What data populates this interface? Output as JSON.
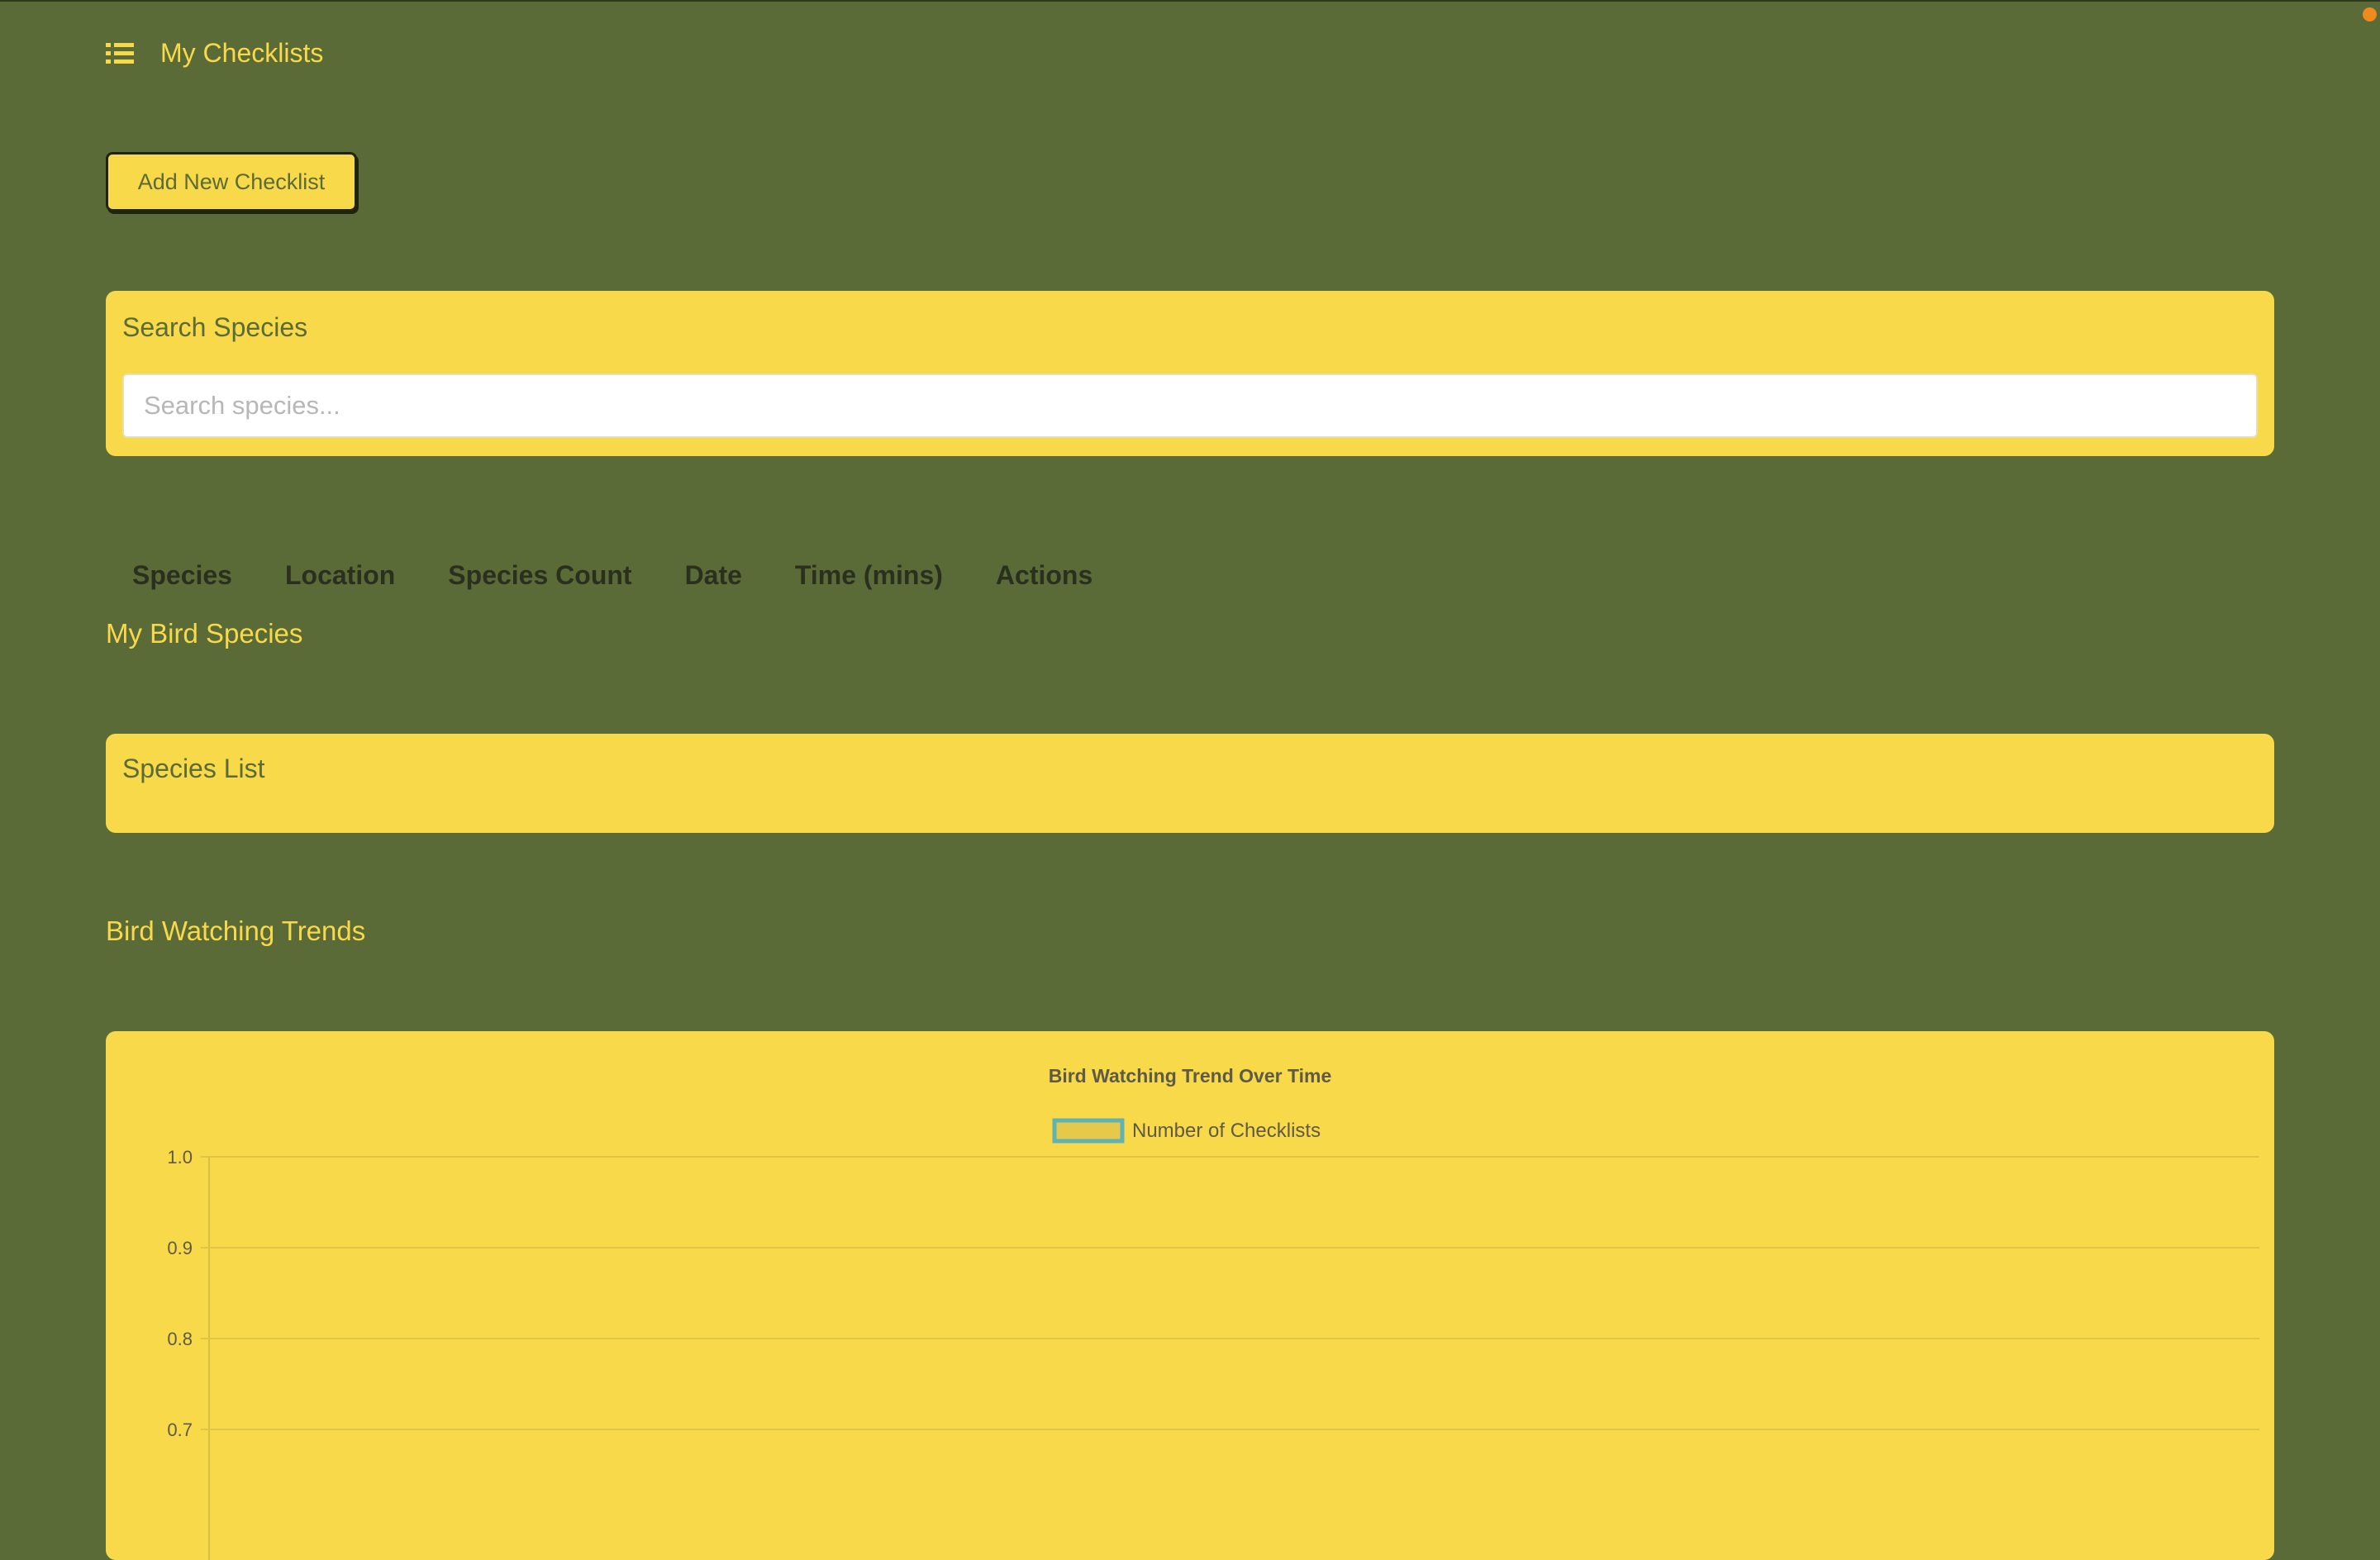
{
  "nav": {
    "title": "My Checklists",
    "icon": "list-icon"
  },
  "toolbar": {
    "add_label": "Add New Checklist"
  },
  "search": {
    "title": "Search Species",
    "placeholder": "Search species..."
  },
  "table": {
    "headers": [
      "Species",
      "Location",
      "Species Count",
      "Date",
      "Time (mins)",
      "Actions"
    ]
  },
  "species_section": {
    "heading": "My Bird Species",
    "card_title": "Species List"
  },
  "trends_section": {
    "heading": "Bird Watching Trends"
  },
  "colors": {
    "background": "#5b6b38",
    "accent": "#f8d94a",
    "legend_border": "#5fb3b3",
    "alert_dot": "#f08a1c"
  },
  "chart_data": {
    "type": "line",
    "title": "Bird Watching Trend Over Time",
    "series": [
      {
        "name": "Number of Checklists",
        "values": []
      }
    ],
    "yticks": [
      1.0,
      0.9,
      0.8,
      0.7
    ],
    "ylim": [
      0.7,
      1.0
    ],
    "grid": true,
    "legend": "top-center"
  }
}
